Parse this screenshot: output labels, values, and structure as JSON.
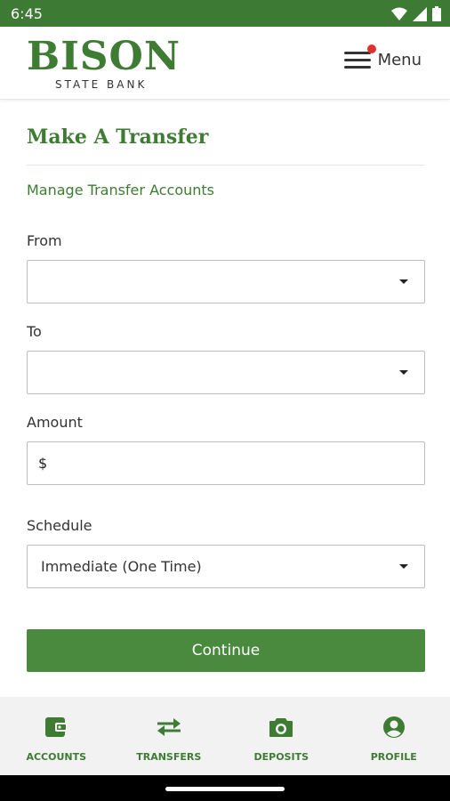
{
  "status_bar": {
    "time": "6:45"
  },
  "header": {
    "logo_main": "BISON",
    "logo_sub": "STATE BANK",
    "menu_label": "Menu"
  },
  "page": {
    "title": "Make A Transfer",
    "manage_link": "Manage Transfer Accounts"
  },
  "form": {
    "from_label": "From",
    "from_value": "",
    "to_label": "To",
    "to_value": "",
    "amount_label": "Amount",
    "amount_prefix": "$",
    "amount_value": "",
    "schedule_label": "Schedule",
    "schedule_value": "Immediate (One Time)",
    "continue_label": "Continue"
  },
  "bottom_nav": {
    "items": [
      {
        "label": "ACCOUNTS",
        "icon": "wallet-icon"
      },
      {
        "label": "TRANSFERS",
        "icon": "swap-arrows-icon"
      },
      {
        "label": "DEPOSITS",
        "icon": "camera-icon"
      },
      {
        "label": "PROFILE",
        "icon": "account-circle-icon"
      }
    ]
  },
  "colors": {
    "brand_green": "#3e7c33",
    "status_bar": "#3d7a33",
    "button": "#4a8a3f",
    "notification_dot": "#e0302e"
  }
}
